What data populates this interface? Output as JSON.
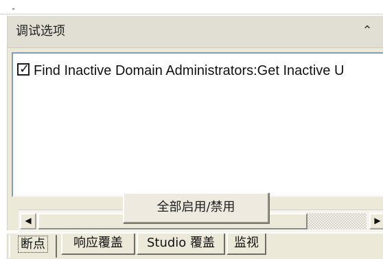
{
  "panel": {
    "title": "调试选项",
    "collapse_icon": "double-chevron-up-icon",
    "collapse_glyph": "⌃"
  },
  "list": {
    "items": [
      {
        "checked": true,
        "label": "Find Inactive Domain Administrators:Get Inactive U"
      }
    ]
  },
  "scrollbar": {
    "left_glyph": "◀",
    "right_glyph": "▶"
  },
  "actions": {
    "toggle_all_label": "全部启用/禁用"
  },
  "tabs": [
    {
      "label": "断点",
      "active": true
    },
    {
      "label": "响应覆盖",
      "active": false
    },
    {
      "label": "Studio 覆盖",
      "active": false
    },
    {
      "label": "监视",
      "active": false
    }
  ],
  "colors": {
    "panel_background": "#ece9d8",
    "listbox_border": "#7f9db9",
    "text": "#111111"
  }
}
